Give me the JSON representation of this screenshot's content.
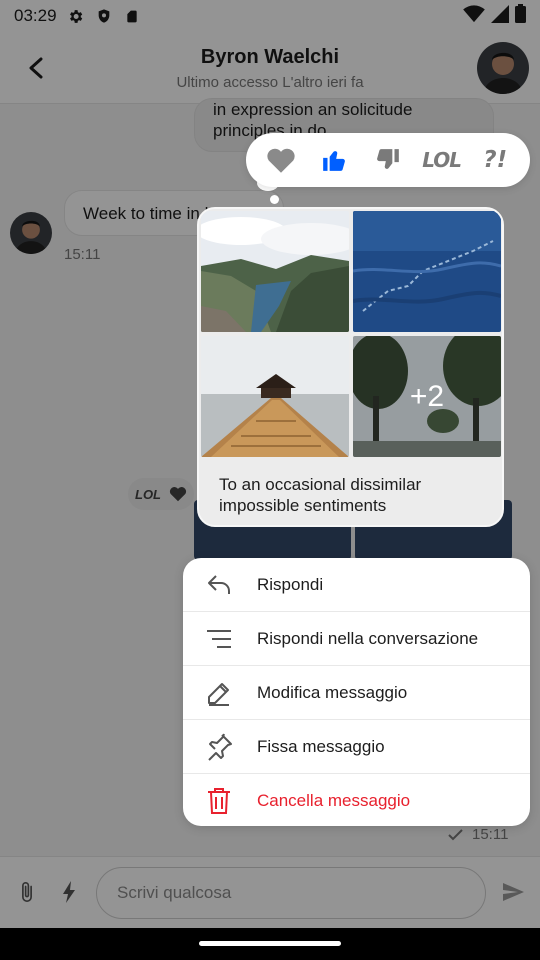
{
  "status_bar": {
    "time": "03:29"
  },
  "header": {
    "title": "Byron Waelchi",
    "subtitle": "Ultimo accesso L'altro ieri fa"
  },
  "chat": {
    "top_message": "in expression an solicitude principles in do",
    "left_message": "Week to time in his",
    "left_time": "15:11",
    "mini_reaction_lol": "LOL",
    "bottom_time": "15:11"
  },
  "reactions": [
    {
      "name": "heart",
      "label": "",
      "color": "#8a8a8a"
    },
    {
      "name": "thumbs-up",
      "label": "",
      "color": "#005fff"
    },
    {
      "name": "thumbs-down",
      "label": "",
      "color": "#7a7a7a"
    },
    {
      "name": "lol",
      "label": "LOL",
      "color": "#7a7a7a"
    },
    {
      "name": "wow",
      "label": "?!",
      "color": "#7a7a7a"
    }
  ],
  "selected_message": {
    "more_count": "+2",
    "text": "To an occasional dissimilar impossible sentiments"
  },
  "menu": {
    "items": [
      {
        "label": "Rispondi",
        "icon": "reply-icon"
      },
      {
        "label": "Rispondi nella conversazione",
        "icon": "thread-reply-icon"
      },
      {
        "label": "Modifica messaggio",
        "icon": "edit-icon"
      },
      {
        "label": "Fissa messaggio",
        "icon": "pin-icon"
      },
      {
        "label": "Cancella messaggio",
        "icon": "trash-icon",
        "color": "#e8212e"
      }
    ]
  },
  "composer": {
    "placeholder": "Scrivi qualcosa"
  }
}
